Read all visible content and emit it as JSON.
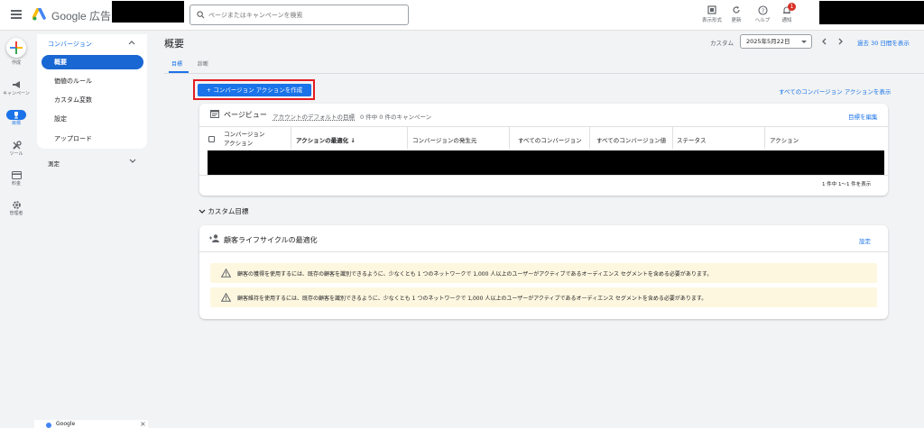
{
  "topbar": {
    "brand": "Google 広告",
    "search_placeholder": "ページまたはキャンペーンを検索",
    "actions": [
      {
        "label": "表示形式",
        "icon": "display-mode-icon"
      },
      {
        "label": "更新",
        "icon": "refresh-icon"
      },
      {
        "label": "ヘルプ",
        "icon": "help-icon"
      },
      {
        "label": "通知",
        "icon": "bell-icon",
        "badge": "1"
      }
    ]
  },
  "rail": {
    "items": [
      {
        "label": "作成",
        "icon": "plus-icon"
      },
      {
        "label": "キャンペーン",
        "icon": "megaphone-icon"
      },
      {
        "label": "目標",
        "icon": "trophy-icon",
        "active": true
      },
      {
        "label": "ツール",
        "icon": "wrench-icon"
      },
      {
        "label": "料金",
        "icon": "card-icon"
      },
      {
        "label": "管理者",
        "icon": "gear-icon"
      }
    ]
  },
  "sidenav": {
    "section": "コンバージョン",
    "items": [
      "概要",
      "価値のルール",
      "カスタム変数",
      "設定",
      "アップロード"
    ],
    "active_index": 0,
    "collapsed_section": "測定"
  },
  "promo": {
    "label": "Google",
    "close": "×"
  },
  "page": {
    "title": "概要",
    "tabs": [
      "目標",
      "診断"
    ],
    "active_tab": 0,
    "date_label": "カスタム",
    "date_value": "2025年5月22日",
    "show_range": "過去 30 日間を表示",
    "create_button": "+ コンバージョン アクションを作成",
    "show_all_link": "すべてのコンバージョン アクションを表示"
  },
  "card_goal": {
    "icon": "page-view-icon",
    "title": "ページビュー",
    "subtitle_link": "アカウントのデフォルトの目標",
    "subtitle": "0 件中 0 件のキャンペーン",
    "edit_link": "目標を編集",
    "columns": [
      "コンバージョン",
      "アクション",
      "アクションの最適化",
      "コンバージョンの発生元",
      "すべてのコンバージョン",
      "すべてのコンバージョン値",
      "ステータス",
      "アクション"
    ],
    "sort_indicator": "↓",
    "pager": "1 件中 1〜1 件を表示"
  },
  "custom_goals": {
    "label": "カスタム目標"
  },
  "card_lifecycle": {
    "title": "顧客ライフサイクルの最適化",
    "settings_link": "設定",
    "warnings": [
      "顧客の獲得を使用するには、既存の顧客を識別できるように、少なくとも 1 つのネットワークで 1,000 人以上のユーザーがアクティブであるオーディエンス セグメントを含める必要があります。",
      "顧客維持を使用するには、既存の顧客を識別できるように、少なくとも 1 つのネットワークで 1,000 人以上のユーザーがアクティブであるオーディエンス セグメントを含める必要があります。"
    ]
  },
  "colors": {
    "accent": "#1a73e8",
    "warning_bg": "#fef7e0",
    "highlight": "#e51c23"
  }
}
